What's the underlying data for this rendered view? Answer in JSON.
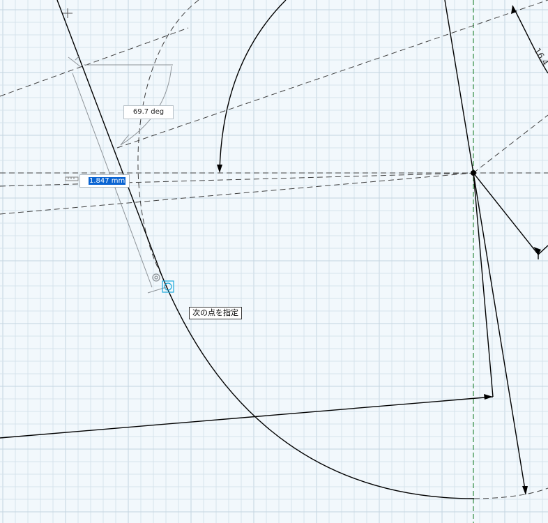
{
  "sketch": {
    "angle_dimension": "69.7 deg",
    "length_input_value": "1.847 mm",
    "linear_dimension_partial": "16.4",
    "prompt_tooltip": "次の点を指定"
  },
  "colors": {
    "background": "#f2f8fc",
    "grid_minor": "#d6e3ec",
    "grid_major": "#c3d4e0",
    "sketch_line": "#000000",
    "construction_line": "#404040",
    "dimension_gray": "#8d9398",
    "axis_green": "#2e8b3e",
    "snap_cyan": "#19a9dc",
    "selection_blue": "#0a64d2"
  },
  "icons": {
    "snap_marker": "snap-point-icon",
    "coincident": "coincident-constraint-icon",
    "ruler": "ruler-icon"
  }
}
